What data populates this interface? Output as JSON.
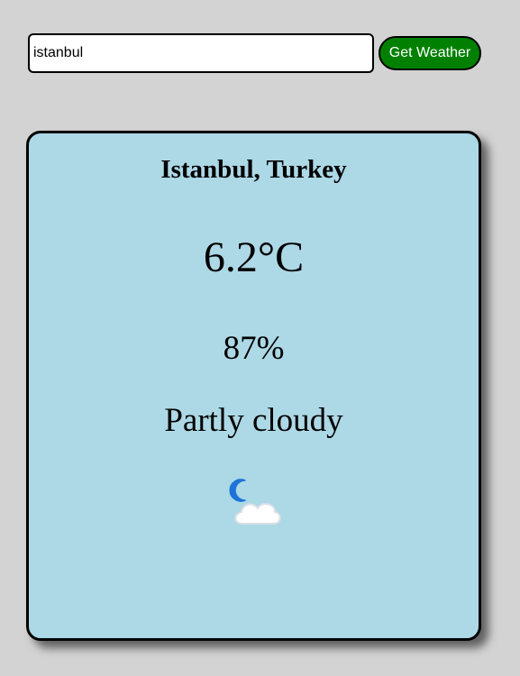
{
  "search": {
    "value": "istanbul",
    "button_label": "Get Weather"
  },
  "weather": {
    "location": "Istanbul, Turkey",
    "temperature": "6.2°C",
    "humidity": "87%",
    "condition": "Partly cloudy",
    "icon": "partly-cloudy-night-icon"
  },
  "colors": {
    "page_background": "#d3d3d3",
    "card_background": "#add8e6",
    "button_background": "#008000",
    "button_text": "#ffffff"
  }
}
